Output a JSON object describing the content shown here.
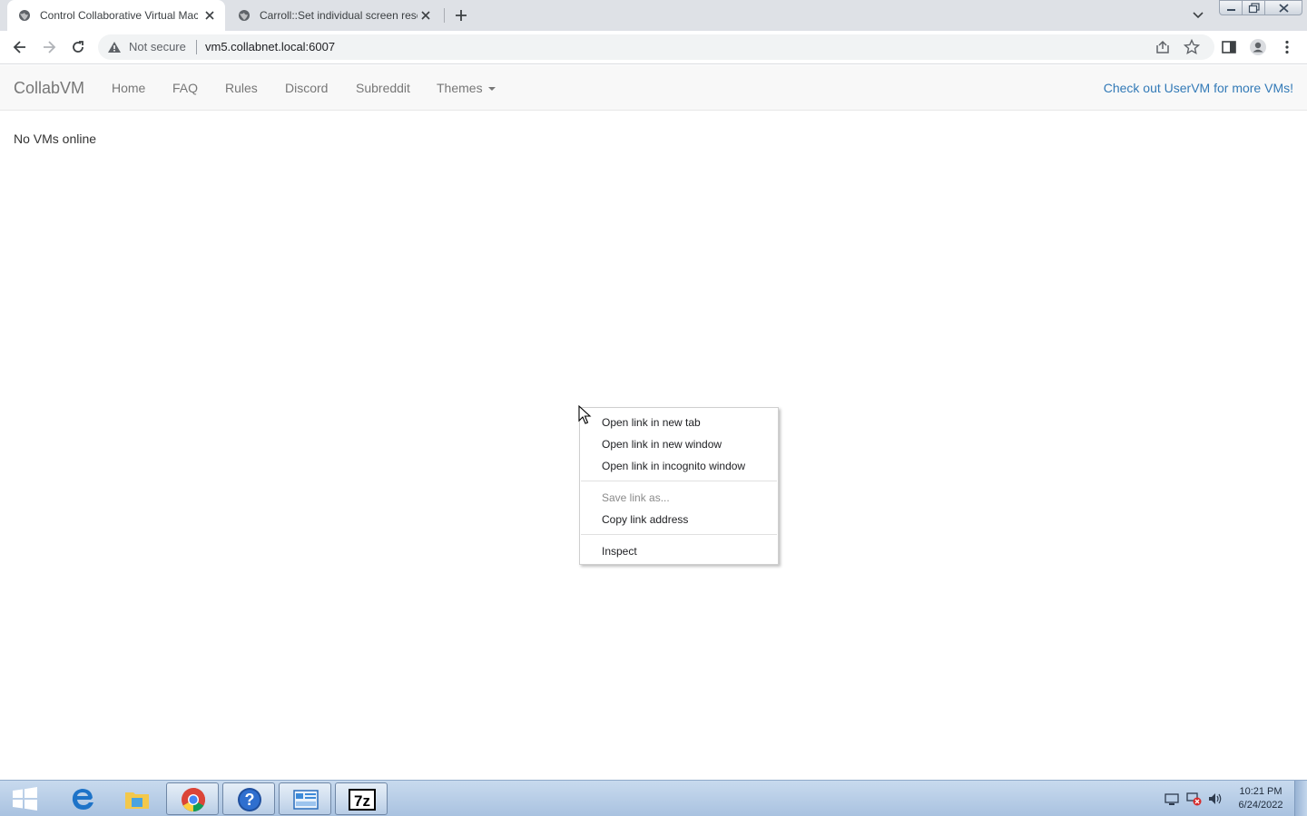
{
  "browser": {
    "tabs": [
      {
        "title": "Control Collaborative Virtual Machines!",
        "active": true
      },
      {
        "title": "Carroll::Set individual screen resolution",
        "active": false
      }
    ],
    "address_bar": {
      "security_label": "Not secure",
      "url": "vm5.collabnet.local:6007"
    }
  },
  "navbar": {
    "brand": "CollabVM",
    "links": [
      "Home",
      "FAQ",
      "Rules",
      "Discord",
      "Subreddit",
      "Themes"
    ],
    "right_link": "Check out UserVM for more VMs!"
  },
  "main": {
    "message": "No VMs online"
  },
  "context_menu": {
    "items": [
      {
        "label": "Open link in new tab",
        "enabled": true
      },
      {
        "label": "Open link in new window",
        "enabled": true
      },
      {
        "label": "Open link in incognito window",
        "enabled": true
      },
      {
        "label": "Save link as...",
        "enabled": false
      },
      {
        "label": "Copy link address",
        "enabled": true
      },
      {
        "label": "Inspect",
        "enabled": true
      }
    ]
  },
  "taskbar": {
    "apps": [
      "internet-explorer",
      "file-explorer",
      "chrome",
      "help",
      "control-panel",
      "7-zip"
    ],
    "sevenzip_label": "7z",
    "clock": {
      "time": "10:21 PM",
      "date": "6/24/2022"
    }
  },
  "colors": {
    "link_blue": "#337ab7",
    "navbar_bg": "#f8f8f8",
    "tabstrip_bg": "#dee1e6",
    "taskbar_bg": "#b8cfe8"
  }
}
